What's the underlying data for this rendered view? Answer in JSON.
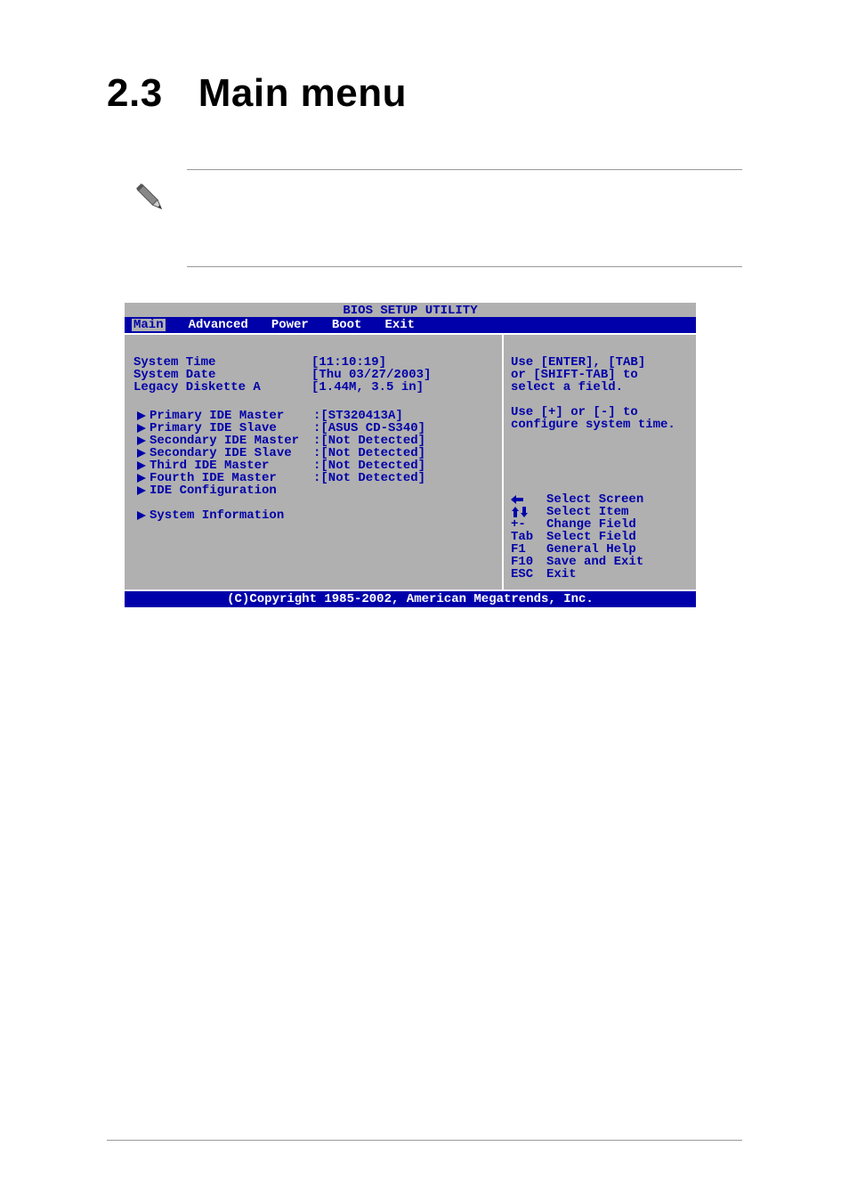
{
  "page": {
    "heading_number": "2.3",
    "heading_title": "Main menu"
  },
  "bios": {
    "title": "BIOS SETUP UTILITY",
    "tabs": {
      "main": "Main",
      "advanced": "Advanced",
      "power": "Power",
      "boot": "Boot",
      "exit": "Exit"
    },
    "fields": {
      "system_time": {
        "label": "System Time",
        "value": "[11:10:19]"
      },
      "system_date": {
        "label": "System Date",
        "value": "[Thu 03/27/2003]"
      },
      "legacy_diskette": {
        "label": "Legacy Diskette A",
        "value": "[1.44M, 3.5 in]"
      }
    },
    "subs": {
      "pri_master": {
        "label": "Primary IDE Master",
        "value": ":[ST320413A]"
      },
      "pri_slave": {
        "label": "Primary IDE Slave",
        "value": ":[ASUS CD-S340]"
      },
      "sec_master": {
        "label": "Secondary IDE Master",
        "value": ":[Not Detected]"
      },
      "sec_slave": {
        "label": "Secondary IDE Slave",
        "value": ":[Not Detected]"
      },
      "third_master": {
        "label": "Third IDE Master",
        "value": ":[Not Detected]"
      },
      "fourth_master": {
        "label": "Fourth IDE Master",
        "value": ":[Not Detected]"
      },
      "ide_config": {
        "label": "IDE Configuration"
      },
      "system_info": {
        "label": "System Information"
      }
    },
    "help": {
      "line1": "Use [ENTER], [TAB]",
      "line2": "or [SHIFT-TAB] to",
      "line3": "select a field.",
      "line4": "Use [+] or [-] to",
      "line5": "configure system time."
    },
    "nav": {
      "select_screen": "Select Screen",
      "select_item": "Select Item",
      "change_field_key": "+-",
      "change_field": "Change Field",
      "select_field_key": "Tab",
      "select_field": "Select Field",
      "general_help_key": "F1",
      "general_help": "General Help",
      "save_exit_key": "F10",
      "save_exit": "Save and Exit",
      "exit_key": "ESC",
      "exit": "Exit"
    },
    "footer": "(C)Copyright 1985-2002, American Megatrends, Inc."
  }
}
